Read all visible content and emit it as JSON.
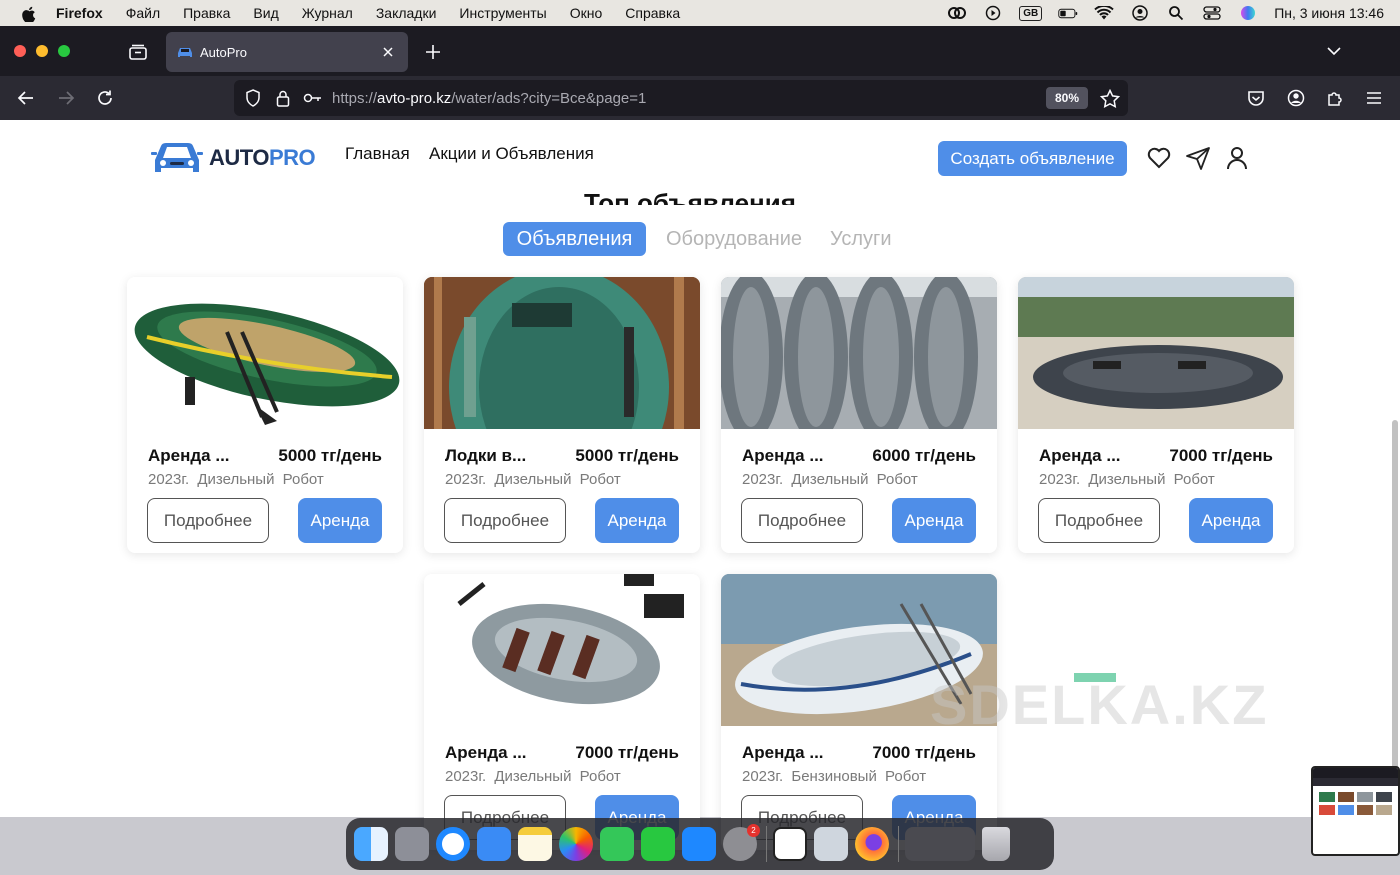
{
  "menubar": {
    "app_name": "Firefox",
    "items": [
      "Файл",
      "Правка",
      "Вид",
      "Журнал",
      "Закладки",
      "Инструменты",
      "Окно",
      "Справка"
    ],
    "keyboard_layout": "GB",
    "datetime": "Пн, 3 июня  13:46"
  },
  "browser": {
    "tab_title": "AutoPro",
    "url_scheme": "https://",
    "url_host": "avto-pro.kz",
    "url_path": "/water/ads?city=Все&page=1",
    "zoom": "80%"
  },
  "header": {
    "logo_part1": "AUTO",
    "logo_part2": "PRO",
    "nav": [
      "Главная",
      "Акции и Объявления"
    ],
    "create_button": "Создать объявление"
  },
  "main": {
    "section_title": "Топ объявления",
    "tabs": [
      {
        "label": "Объявления",
        "active": true
      },
      {
        "label": "Оборудование",
        "active": false
      },
      {
        "label": "Услуги",
        "active": false
      }
    ],
    "more_label": "Подробнее",
    "rent_label": "Аренда",
    "listings": [
      {
        "title": "Аренда ...",
        "price": "5000 тг/день",
        "year": "2023г.",
        "fuel": "Дизельный",
        "gearbox": "Робот"
      },
      {
        "title": "Лодки в...",
        "price": "5000 тг/день",
        "year": "2023г.",
        "fuel": "Дизельный",
        "gearbox": "Робот"
      },
      {
        "title": "Аренда ...",
        "price": "6000 тг/день",
        "year": "2023г.",
        "fuel": "Дизельный",
        "gearbox": "Робот"
      },
      {
        "title": "Аренда ...",
        "price": "7000 тг/день",
        "year": "2023г.",
        "fuel": "Дизельный",
        "gearbox": "Робот"
      },
      {
        "title": "Аренда ...",
        "price": "7000 тг/день",
        "year": "2023г.",
        "fuel": "Дизельный",
        "gearbox": "Робот"
      },
      {
        "title": "Аренда ...",
        "price": "7000 тг/день",
        "year": "2023г.",
        "fuel": "Бензиновый",
        "gearbox": "Робот"
      }
    ],
    "watermark": "SDELKA.KZ"
  },
  "dock": {
    "badge_count": "2"
  },
  "colors": {
    "accent": "#4f8ee8",
    "browser_bg": "#1c1b22"
  }
}
